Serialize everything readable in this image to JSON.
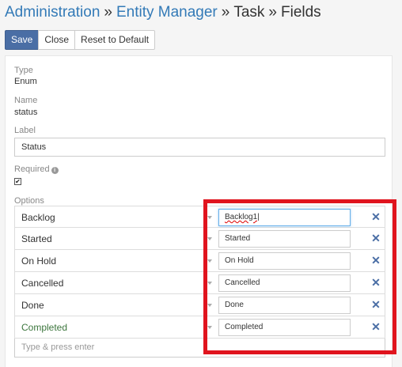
{
  "breadcrumb": {
    "items": [
      "Administration",
      "Entity Manager",
      "Task",
      "Fields"
    ],
    "separator": "»"
  },
  "toolbar": {
    "save_label": "Save",
    "close_label": "Close",
    "reset_label": "Reset to Default"
  },
  "fields": {
    "type_label": "Type",
    "type_value": "Enum",
    "name_label": "Name",
    "name_value": "status",
    "label_label": "Label",
    "label_value": "Status",
    "required_label": "Required",
    "required_checked": true,
    "options_label": "Options"
  },
  "options": [
    {
      "name": "Backlog",
      "value": "Backlog1|"
    },
    {
      "name": "Started",
      "value": "Started"
    },
    {
      "name": "On Hold",
      "value": "On Hold"
    },
    {
      "name": "Cancelled",
      "value": "Cancelled"
    },
    {
      "name": "Done",
      "value": "Done"
    },
    {
      "name": "Completed",
      "value": "Completed"
    }
  ],
  "add_option_placeholder": "Type & press enter",
  "colors": {
    "primary": "#4a6ea5",
    "link": "#337ab7",
    "highlight": "#e0141e",
    "completed_text": "#3c763d"
  }
}
